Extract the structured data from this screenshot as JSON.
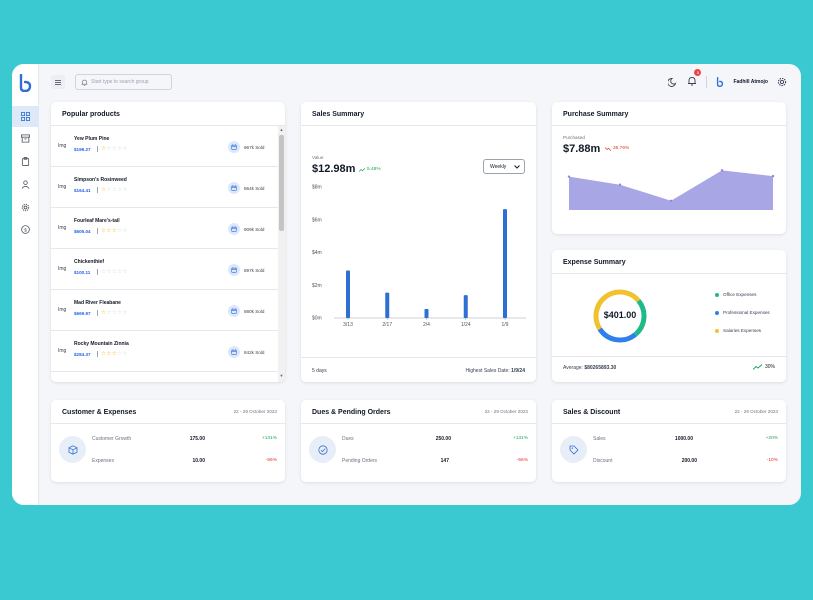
{
  "header": {
    "search_placeholder": "Start type to search group",
    "notification_count": "5",
    "user_name": "Fadhill Atmojo"
  },
  "popular_products": {
    "title": "Popular products",
    "image_placeholder": "Img",
    "items": [
      {
        "name": "Yew Plum Pine",
        "price": "$199.27",
        "rating": 1,
        "sold": "967k Sold"
      },
      {
        "name": "Simpson's Rosinweed",
        "price": "$164.41",
        "rating": 1,
        "sold": "864k Sold"
      },
      {
        "name": "Fourleaf Mare's-tail",
        "price": "$605.04",
        "rating": 3,
        "sold": "909k Sold"
      },
      {
        "name": "Chickenthief",
        "price": "$100.11",
        "rating": 0,
        "sold": "897k Sold"
      },
      {
        "name": "Mad River Fleabane",
        "price": "$669.97",
        "rating": 1,
        "sold": "880k Sold"
      },
      {
        "name": "Rocky Mountain Zinnia",
        "price": "$284.37",
        "rating": 3,
        "sold": "842k Sold"
      }
    ]
  },
  "sales_summary": {
    "title": "Sales Summary",
    "value_label": "Value",
    "value": "$12.98m",
    "change": "5.48%",
    "period_select": "Weekly",
    "footer_left": "5 days",
    "footer_right_label": "Highest Sales Date:",
    "footer_right_value": "1/9/24"
  },
  "purchase_summary": {
    "title": "Purchase Summary",
    "label": "Purchased",
    "value": "$7.88m",
    "change": "35.76%"
  },
  "expense_summary": {
    "title": "Expense Summary",
    "total": "$401.00",
    "legend": [
      {
        "name": "Office Expenses",
        "color": "#1fb98a"
      },
      {
        "name": "Professional Expenses",
        "color": "#2f80ed"
      },
      {
        "name": "Salaries Expenses",
        "color": "#f2c12e"
      }
    ],
    "average_label": "Average:",
    "average_value": "$80265893.30",
    "change": "30%"
  },
  "customer_expenses": {
    "title": "Customer & Expenses",
    "date": "22 - 29 October 2023",
    "rows": [
      {
        "label": "Customer Growth",
        "value": "175.00",
        "change": "+131%",
        "positive": true
      },
      {
        "label": "Expenses",
        "value": "10.00",
        "change": "-56%",
        "positive": false
      }
    ]
  },
  "dues_orders": {
    "title": "Dues & Pending Orders",
    "date": "22 - 29 October 2023",
    "rows": [
      {
        "label": "Dues",
        "value": "250.00",
        "change": "+131%",
        "positive": true
      },
      {
        "label": "Pending Orders",
        "value": "147",
        "change": "-56%",
        "positive": false
      }
    ]
  },
  "sales_discount": {
    "title": "Sales & Discount",
    "date": "22 - 29 October 2023",
    "rows": [
      {
        "label": "Sales",
        "value": "1000.00",
        "change": "+20%",
        "positive": true
      },
      {
        "label": "Discount",
        "value": "200.00",
        "change": "-10%",
        "positive": false
      }
    ]
  },
  "chart_data": [
    {
      "type": "bar",
      "categories": [
        "3/13",
        "2/17",
        "2/4",
        "1/24",
        "1/9"
      ],
      "x": [
        0,
        2,
        4,
        6,
        8
      ],
      "values": [
        2.9,
        1.55,
        0.55,
        1.4,
        6.65
      ],
      "ylim": [
        0,
        8
      ],
      "yticks": [
        "$0m",
        "$2m",
        "$4m",
        "$6m",
        "$8m"
      ],
      "color": "#2f6fd3"
    },
    {
      "type": "area",
      "values": [
        5.8,
        4.4,
        1.6,
        6.9,
        5.9
      ],
      "ylim": [
        0,
        8
      ],
      "color": "#a9a6e6"
    },
    {
      "type": "pie",
      "labels": [
        "Office Expenses",
        "Professional Expenses",
        "Salaries Expenses"
      ],
      "values": [
        25,
        27,
        48
      ],
      "colors": [
        "#1fb98a",
        "#2f80ed",
        "#f2c12e"
      ]
    }
  ]
}
